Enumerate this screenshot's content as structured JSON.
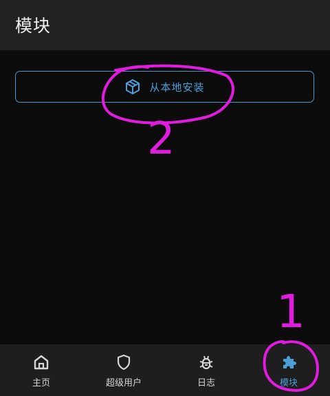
{
  "app_bar": {
    "title": "模块"
  },
  "install_button": {
    "label": "从本地安装",
    "icon": "box-icon"
  },
  "annotations": {
    "step_1": "1",
    "step_2": "2"
  },
  "bottom_nav": {
    "items": [
      {
        "label": "主页",
        "icon": "home-icon",
        "active": false
      },
      {
        "label": "超级用户",
        "icon": "shield-icon",
        "active": false
      },
      {
        "label": "日志",
        "icon": "bug-icon",
        "active": false
      },
      {
        "label": "模块",
        "icon": "puzzle-icon",
        "active": true
      }
    ]
  },
  "colors": {
    "accent": "#4d9fd8",
    "annotation": "#e01cde",
    "app_bar_bg": "#212121",
    "nav_bg": "#1e1e1e",
    "page_bg": "#0c0c0c"
  }
}
